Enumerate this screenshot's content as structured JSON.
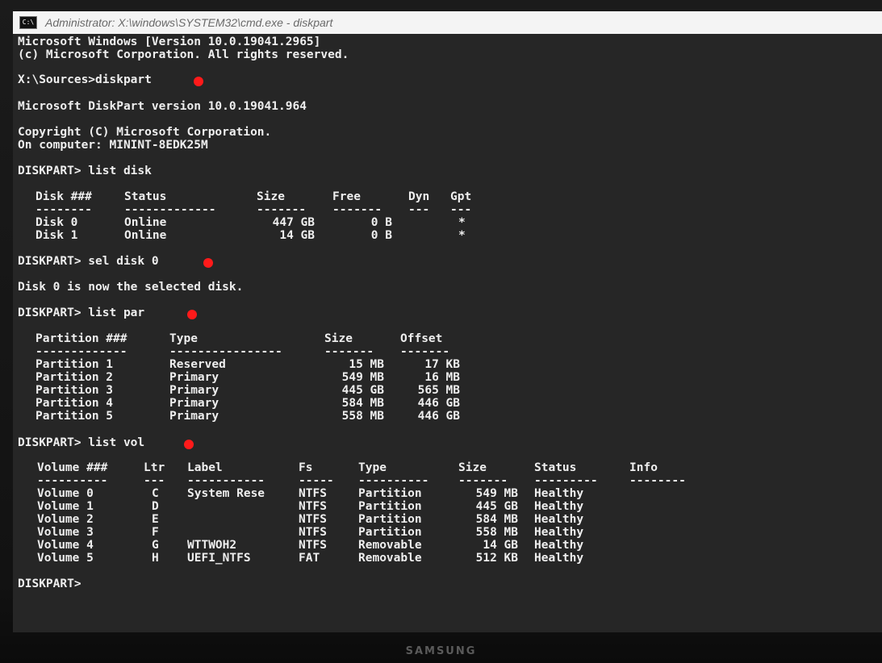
{
  "window": {
    "title": "Administrator: X:\\windows\\SYSTEM32\\cmd.exe - diskpart",
    "icon_text": "C:\\"
  },
  "console": {
    "header1": "Microsoft Windows [Version 10.0.19041.2965]",
    "header2": "(c) Microsoft Corporation. All rights reserved.",
    "prompt1": "X:\\Sources>diskpart",
    "dp_version": "Microsoft DiskPart version 10.0.19041.964",
    "copyright": "Copyright (C) Microsoft Corporation.",
    "computer": "On computer: MININT-8EDK25M",
    "cmd_list_disk": "DISKPART> list disk",
    "cmd_sel_disk": "DISKPART> sel disk 0",
    "sel_result": "Disk 0 is now the selected disk.",
    "cmd_list_par": "DISKPART> list par",
    "cmd_list_vol": "DISKPART> list vol",
    "final_prompt": "DISKPART>"
  },
  "disk_table": {
    "headers": [
      "Disk ###",
      "Status",
      "Size",
      "Free",
      "Dyn",
      "Gpt"
    ],
    "separators": [
      "--------",
      "-------------",
      "-------",
      "-------",
      "---",
      "---"
    ],
    "rows": [
      [
        "Disk 0",
        "Online",
        "447 GB",
        "0 B",
        "",
        "*"
      ],
      [
        "Disk 1",
        "Online",
        "14 GB",
        "0 B",
        "",
        "*"
      ]
    ]
  },
  "partition_table": {
    "headers": [
      "Partition ###",
      "Type",
      "Size",
      "Offset"
    ],
    "separators": [
      "-------------",
      "----------------",
      "-------",
      "-------"
    ],
    "rows": [
      [
        "Partition 1",
        "Reserved",
        "15 MB",
        "17 KB"
      ],
      [
        "Partition 2",
        "Primary",
        "549 MB",
        "16 MB"
      ],
      [
        "Partition 3",
        "Primary",
        "445 GB",
        "565 MB"
      ],
      [
        "Partition 4",
        "Primary",
        "584 MB",
        "446 GB"
      ],
      [
        "Partition 5",
        "Primary",
        "558 MB",
        "446 GB"
      ]
    ]
  },
  "volume_table": {
    "headers": [
      "Volume ###",
      "Ltr",
      "Label",
      "Fs",
      "Type",
      "Size",
      "Status",
      "Info"
    ],
    "separators": [
      "----------",
      "---",
      "-----------",
      "-----",
      "----------",
      "-------",
      "---------",
      "--------"
    ],
    "rows": [
      [
        "Volume 0",
        "C",
        "System Rese",
        "NTFS",
        "Partition",
        "549 MB",
        "Healthy",
        ""
      ],
      [
        "Volume 1",
        "D",
        "",
        "NTFS",
        "Partition",
        "445 GB",
        "Healthy",
        ""
      ],
      [
        "Volume 2",
        "E",
        "",
        "NTFS",
        "Partition",
        "584 MB",
        "Healthy",
        ""
      ],
      [
        "Volume 3",
        "F",
        "",
        "NTFS",
        "Partition",
        "558 MB",
        "Healthy",
        ""
      ],
      [
        "Volume 4",
        "G",
        "WTTWOH2",
        "NTFS",
        "Removable",
        "14 GB",
        "Healthy",
        ""
      ],
      [
        "Volume 5",
        "H",
        "UEFI_NTFS",
        "FAT",
        "Removable",
        "512 KB",
        "Healthy",
        ""
      ]
    ]
  },
  "monitor": {
    "brand": "SAMSUNG"
  },
  "colors": {
    "annotation_dot": "#ff1a1a",
    "console_bg": "#262626",
    "console_text": "#eeeeee"
  }
}
